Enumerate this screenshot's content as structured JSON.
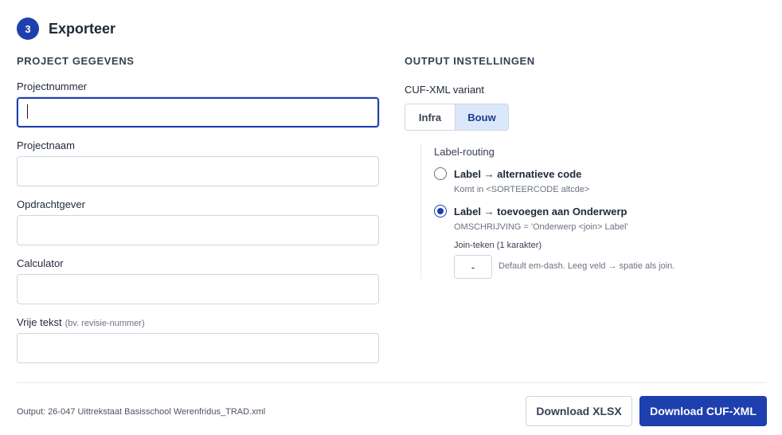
{
  "header": {
    "step_number": "3",
    "title": "Exporteer"
  },
  "project": {
    "section_title": "PROJECT GEGEVENS",
    "fields": [
      {
        "label": "Projectnummer",
        "value": "",
        "placeholder": ""
      },
      {
        "label": "Projectnaam",
        "value": "",
        "placeholder": ""
      },
      {
        "label": "Opdrachtgever",
        "value": "",
        "placeholder": ""
      },
      {
        "label": "Calculator",
        "value": "",
        "placeholder": ""
      },
      {
        "label": "Vrije tekst",
        "hint": "(bv. revisie-nummer)",
        "value": "",
        "placeholder": ""
      }
    ]
  },
  "output_settings": {
    "section_title": "OUTPUT INSTELLINGEN",
    "variant_label": "CUF-XML variant",
    "variants": [
      "Infra",
      "Bouw"
    ],
    "selected_variant": "Bouw",
    "routing": {
      "title": "Label-routing",
      "options": [
        {
          "label": "Label → alternatieve code",
          "description": "Komt in <SORTEERCODE altcde>",
          "checked": false
        },
        {
          "label": "Label → toevoegen aan Onderwerp",
          "description": "OMSCHRIJVING = 'Onderwerp <join> Label'",
          "checked": true
        }
      ],
      "join_label": "Join-teken (1 karakter)",
      "join_value": "-",
      "join_hint": "Default em-dash. Leeg veld → spatie als join."
    }
  },
  "footer": {
    "output_text": "Output: 26-047 Uittrekstaat Basisschool Werenfridus_TRAD.xml",
    "download_xlsx": "Download XLSX",
    "download_cuf": "Download CUF-XML"
  },
  "colors": {
    "accent": "#1e3fae",
    "segment_selected_bg": "#dbe7fb",
    "border": "#d1d5db"
  }
}
